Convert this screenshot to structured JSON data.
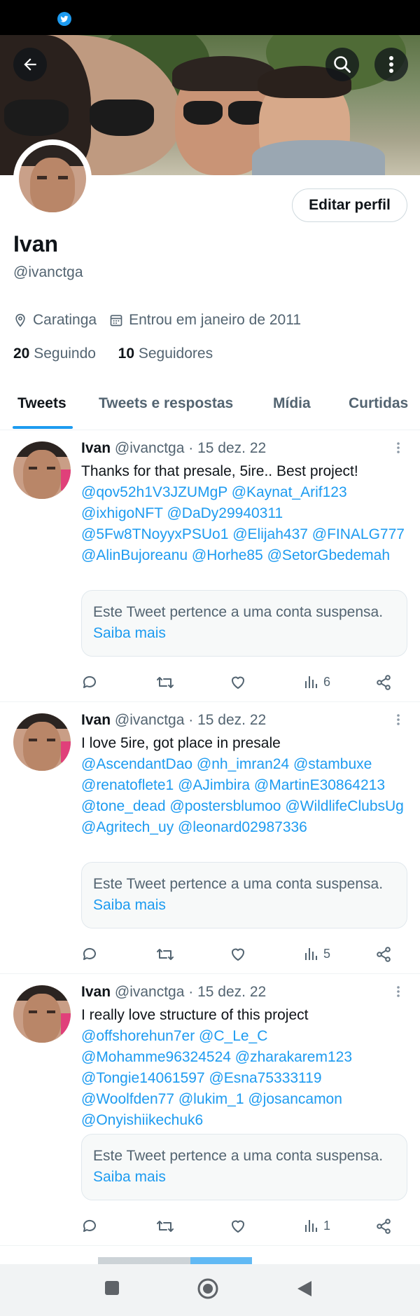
{
  "profile": {
    "name": "Ivan",
    "handle": "@ivanctga",
    "location": "Caratinga",
    "joined": "Entrou em janeiro de 2011",
    "following_count": "20",
    "following_label": "Seguindo",
    "followers_count": "10",
    "followers_label": "Seguidores",
    "edit_button": "Editar perfil"
  },
  "icons": {
    "status": "twitter-bird-icon",
    "back": "back-arrow-icon",
    "search": "search-icon",
    "more": "more-vertical-icon",
    "location": "location-pin-icon",
    "calendar": "calendar-icon",
    "reply": "reply-icon",
    "retweet": "retweet-icon",
    "like": "heart-icon",
    "views": "views-bar-icon",
    "share": "share-icon"
  },
  "colors": {
    "accent": "#1d9bf0",
    "text": "#0f1419",
    "muted": "#536471"
  },
  "tabs": [
    {
      "label": "Tweets",
      "active": true
    },
    {
      "label": "Tweets e respostas",
      "active": false
    },
    {
      "label": "Mídia",
      "active": false
    },
    {
      "label": "Curtidas",
      "active": false
    }
  ],
  "tweets": [
    {
      "name": "Ivan",
      "handle": "@ivanctga",
      "date": "· 15 dez. 22",
      "text": "Thanks for that presale, 5ire.. Best project!",
      "mentions": "@qov52h1V3JZUMgP @Kaynat_Arif123 @ixhigoNFT @DaDy29940311 @5Fw8TNoyyxPSUo1 @Elijah437 @FINALG777 @AlinBujoreanu @Horhe85 @SetorGbedemah",
      "notice": "Este Tweet pertence a uma conta suspensa.",
      "notice_link": "Saiba mais",
      "views": "6"
    },
    {
      "name": "Ivan",
      "handle": "@ivanctga",
      "date": "· 15 dez. 22",
      "text": "I love 5ire, got place in presale",
      "mentions": "@AscendantDao @nh_imran24 @stambuxe @renatoflete1 @AJimbira @MartinE30864213 @tone_dead @postersblumoo @WildlifeClubsUg @Agritech_uy @leonard02987336",
      "notice": "Este Tweet pertence a uma conta suspensa.",
      "notice_link": "Saiba mais",
      "views": "5"
    },
    {
      "name": "Ivan",
      "handle": "@ivanctga",
      "date": "· 15 dez. 22",
      "text": "I really love structure of this project",
      "mentions": "@offshorehun7er @C_Le_C @Mohamme96324524 @zharakarem123 @Tongie14061597 @Esna75333119 @Woolfden77 @lukim_1 @josancamon @Onyishiikechuk6",
      "notice": "Este Tweet pertence a uma conta suspensa.",
      "notice_link": "Saiba mais",
      "views": "1"
    }
  ],
  "navbar": {
    "recents": "square-recents-icon",
    "home": "circle-home-icon",
    "back": "triangle-back-icon"
  }
}
